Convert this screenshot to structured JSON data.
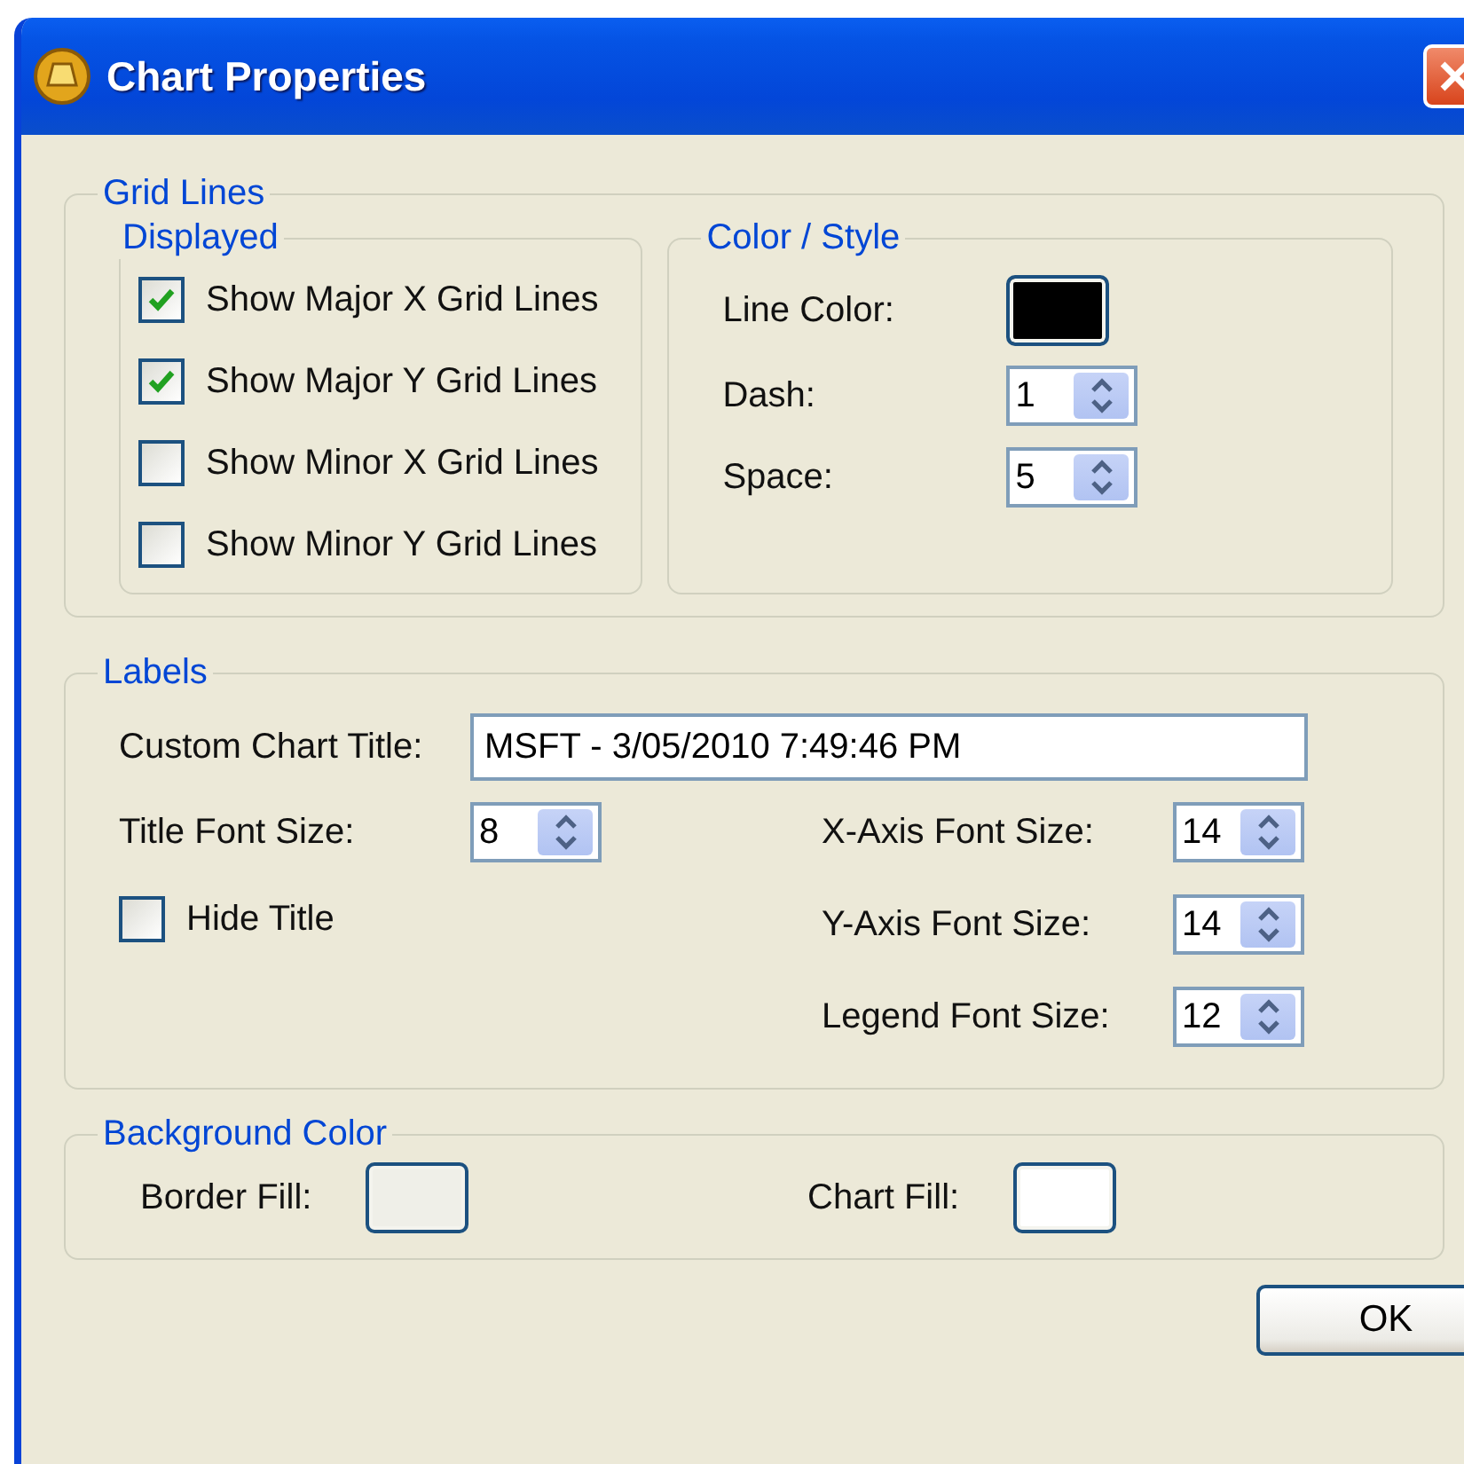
{
  "window": {
    "title": "Chart Properties"
  },
  "grid_lines": {
    "title": "Grid Lines",
    "displayed": {
      "title": "Displayed",
      "options": [
        {
          "label": "Show Major X Grid Lines",
          "checked": true
        },
        {
          "label": "Show Major Y Grid Lines",
          "checked": true
        },
        {
          "label": "Show Minor X Grid Lines",
          "checked": false
        },
        {
          "label": "Show Minor Y Grid Lines",
          "checked": false
        }
      ]
    },
    "color_style": {
      "title": "Color / Style",
      "line_color": {
        "label": "Line Color:",
        "color": "#000000"
      },
      "spinners": [
        {
          "label": "Dash:",
          "value": "1"
        },
        {
          "label": "Space:",
          "value": "5"
        }
      ]
    }
  },
  "labels": {
    "title": "Labels",
    "custom_title": {
      "label": "Custom Chart Title:",
      "value": "MSFT - 3/05/2010 7:49:46 PM"
    },
    "title_font_size": {
      "label": "Title Font Size:",
      "value": "8"
    },
    "hide_title": {
      "label": "Hide Title",
      "checked": false
    },
    "font_sizes": [
      {
        "label": "X-Axis Font Size:",
        "value": "14"
      },
      {
        "label": "Y-Axis Font Size:",
        "value": "14"
      },
      {
        "label": "Legend Font Size:",
        "value": "12"
      }
    ]
  },
  "background_color": {
    "title": "Background Color",
    "fills": [
      {
        "label": "Border Fill:",
        "color": "#efefe8"
      },
      {
        "label": "Chart Fill:",
        "color": "#ffffff"
      }
    ]
  },
  "buttons": [
    {
      "label": "OK"
    }
  ]
}
